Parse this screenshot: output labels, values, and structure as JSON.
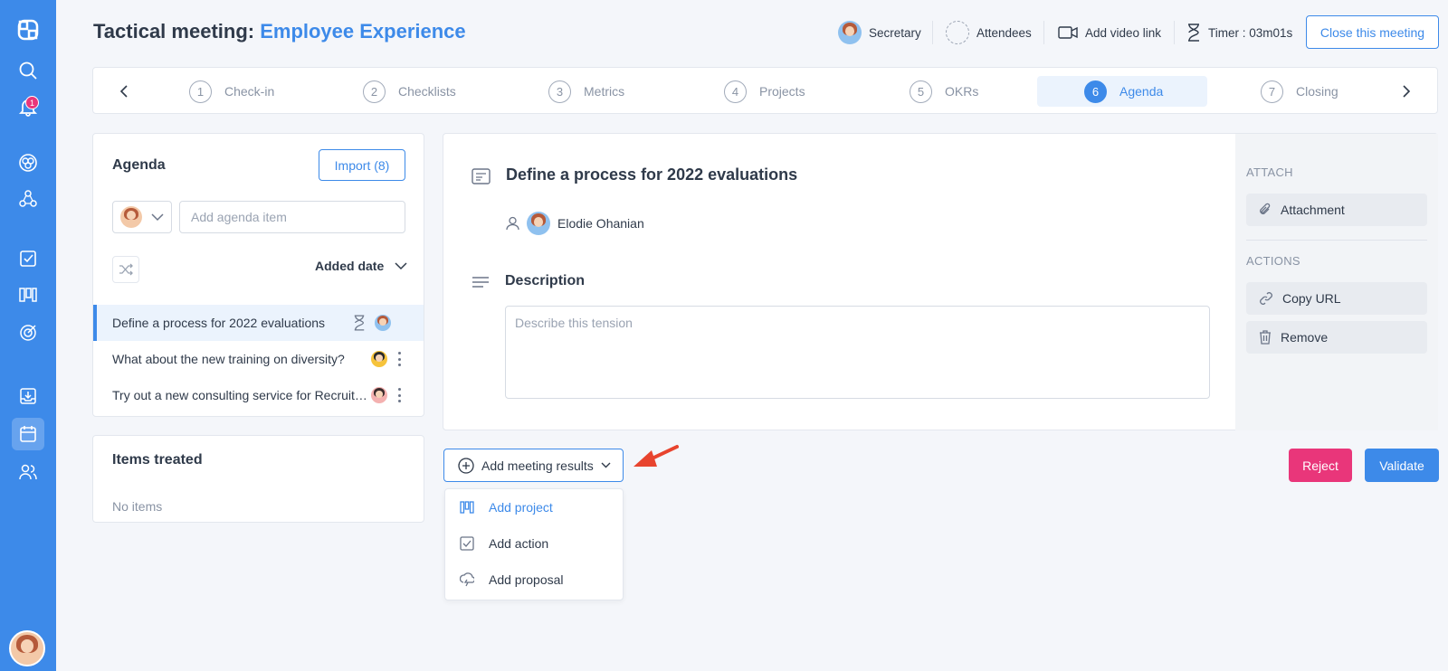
{
  "header": {
    "title_prefix": "Tactical meeting: ",
    "title_accent": "Employee Experience",
    "secretary": "Secretary",
    "attendees": "Attendees",
    "video": "Add video link",
    "timer": "Timer : 03m01s",
    "close": "Close this meeting"
  },
  "nav": {
    "notifications": "1"
  },
  "steps": [
    {
      "num": "1",
      "label": "Check-in"
    },
    {
      "num": "2",
      "label": "Checklists"
    },
    {
      "num": "3",
      "label": "Metrics"
    },
    {
      "num": "4",
      "label": "Projects"
    },
    {
      "num": "5",
      "label": "OKRs"
    },
    {
      "num": "6",
      "label": "Agenda"
    },
    {
      "num": "7",
      "label": "Closing"
    }
  ],
  "agenda": {
    "title": "Agenda",
    "import": "Import (8)",
    "placeholder": "Add agenda item",
    "sort": "Added date",
    "items": [
      "Define a process for 2022 evaluations",
      "What about the new training on diversity?",
      "Try out a new consulting service for Recruitment"
    ]
  },
  "treated": {
    "title": "Items treated",
    "empty": "No items"
  },
  "detail": {
    "title": "Define a process for 2022 evaluations",
    "owner": "Elodie Ohanian",
    "description_label": "Description",
    "description_placeholder": "Describe this tension"
  },
  "side": {
    "attach_label": "ATTACH",
    "attachment": "Attachment",
    "actions_label": "ACTIONS",
    "copy_url": "Copy URL",
    "remove": "Remove"
  },
  "results": {
    "button": "Add meeting results",
    "menu": [
      "Add project",
      "Add action",
      "Add proposal"
    ]
  },
  "buttons": {
    "reject": "Reject",
    "validate": "Validate"
  },
  "colors": {
    "accent": "#3d8ae9",
    "reject": "#e9367a",
    "text": "#2f3a4a"
  }
}
